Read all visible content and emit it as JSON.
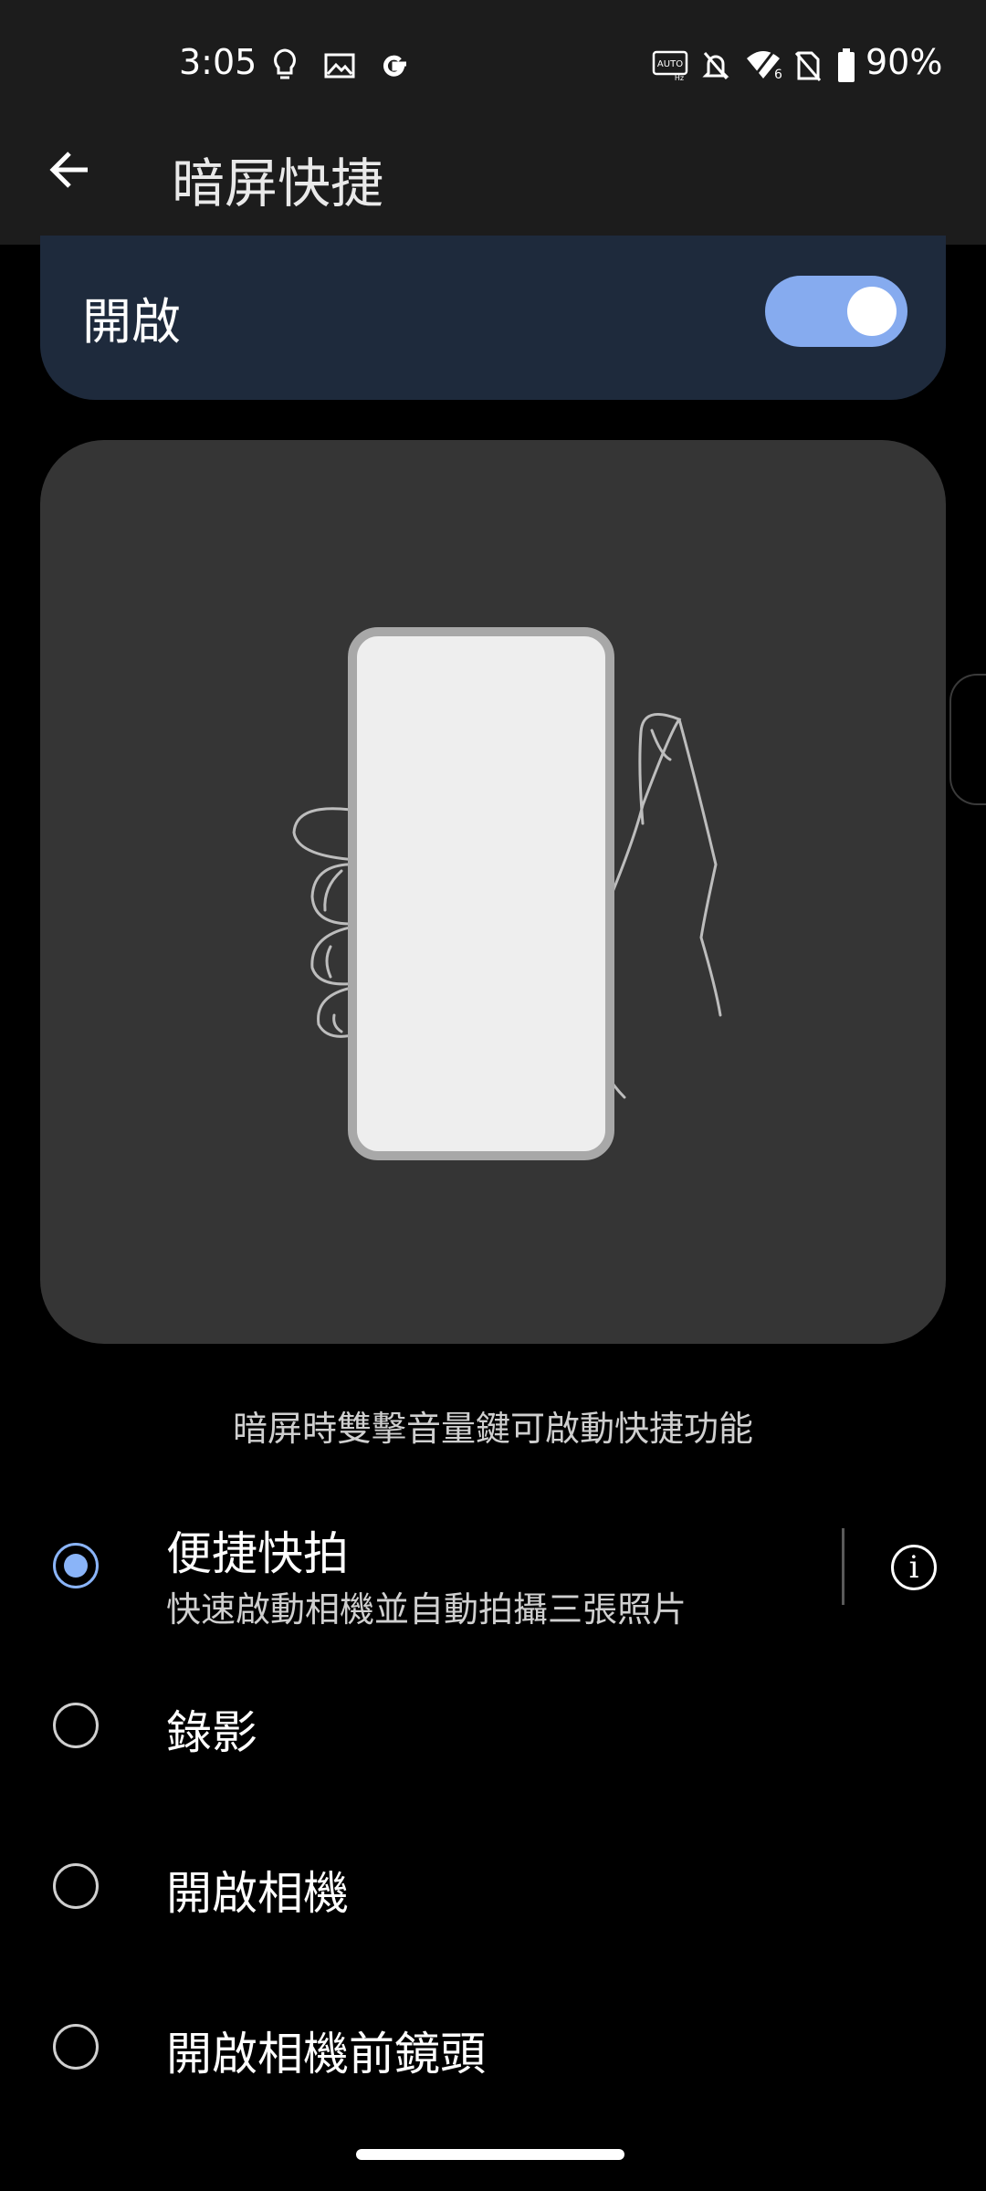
{
  "status_bar": {
    "time": "3:05",
    "battery_percent": "90%",
    "icons": [
      "lightbulb-icon",
      "image-icon",
      "google-icon",
      "auto-hz-icon",
      "bell-off-icon",
      "wifi-icon",
      "no-sim-icon",
      "battery-icon"
    ],
    "auto_label": "AUTO",
    "hz_label": "Hz",
    "wifi_badge": "6"
  },
  "app_bar": {
    "title": "暗屏快捷",
    "back_icon": "arrow-left-icon"
  },
  "toggle": {
    "label": "開啟",
    "on": true,
    "color": "#86abef"
  },
  "illustration": {
    "description_icon": "hand-holding-phone-illustration"
  },
  "caption": "暗屏時雙擊音量鍵可啟動快捷功能",
  "options": [
    {
      "title": "便捷快拍",
      "subtitle": "快速啟動相機並自動拍攝三張照片",
      "selected": true
    },
    {
      "title": "錄影",
      "subtitle": "",
      "selected": false
    },
    {
      "title": "開啟相機",
      "subtitle": "",
      "selected": false
    },
    {
      "title": "開啟相機前鏡頭",
      "subtitle": "",
      "selected": false
    }
  ],
  "info_label": "i",
  "colors": {
    "accent": "#8ab4f8",
    "card": "#1e2a3c",
    "illustration_bg": "#353535"
  }
}
